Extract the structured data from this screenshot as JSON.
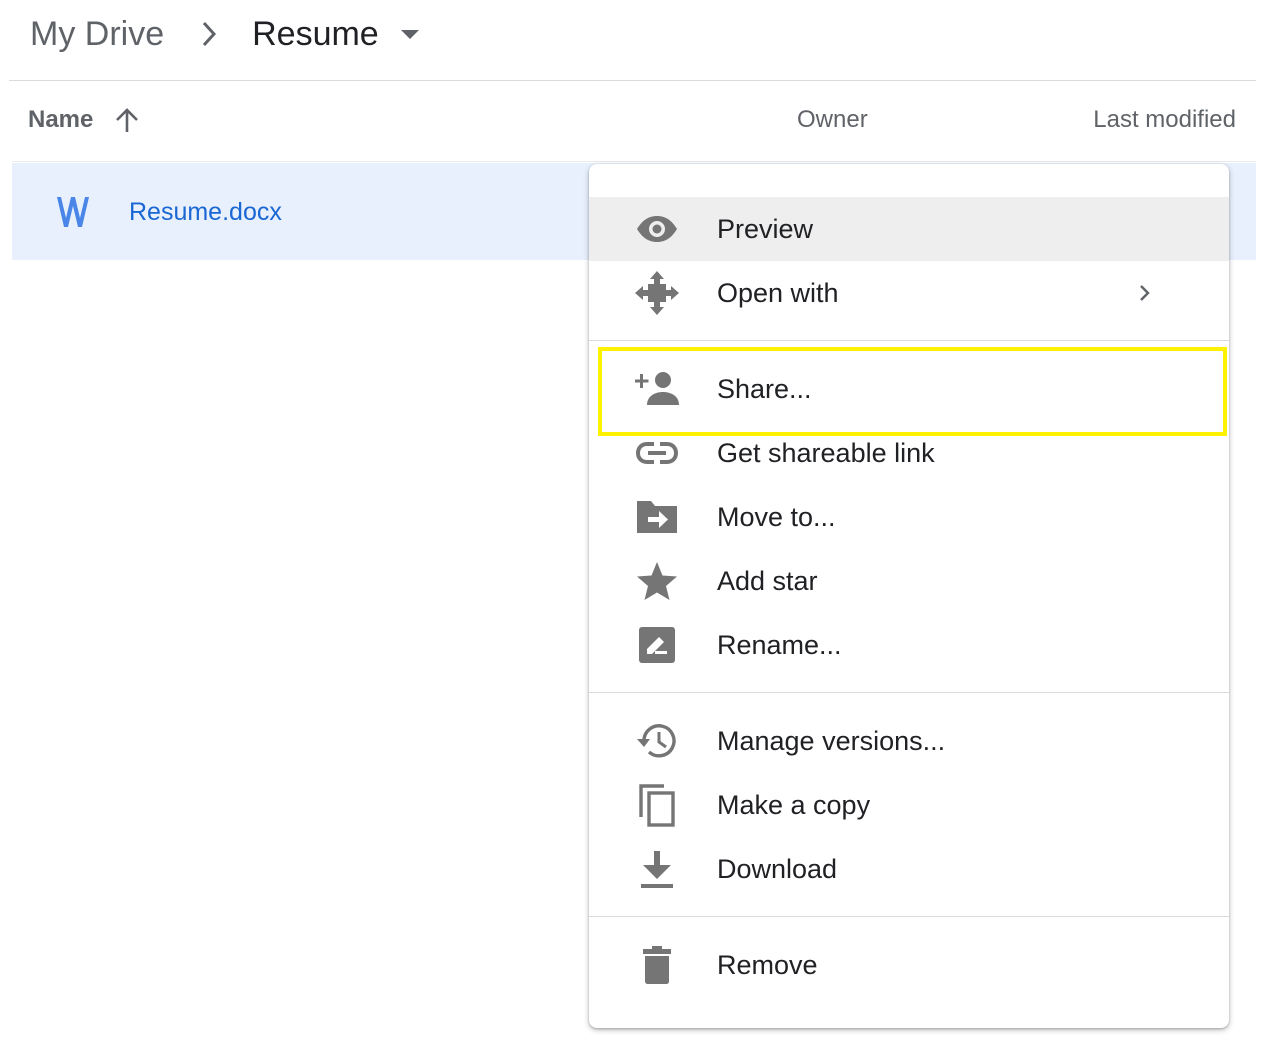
{
  "breadcrumb": {
    "root": "My Drive",
    "current": "Resume"
  },
  "columns": {
    "name": "Name",
    "owner": "Owner",
    "last_modified": "Last modified"
  },
  "file": {
    "name": "Resume.docx",
    "type_icon": "word-doc-icon",
    "icon_color": "#4a86e8"
  },
  "menu": {
    "items": [
      {
        "label": "Preview",
        "icon": "eye-icon"
      },
      {
        "label": "Open with",
        "icon": "open-with-icon"
      },
      {
        "label": "Share...",
        "icon": "add-person-icon"
      },
      {
        "label": "Get shareable link",
        "icon": "link-icon"
      },
      {
        "label": "Move to...",
        "icon": "move-folder-icon"
      },
      {
        "label": "Add star",
        "icon": "star-icon"
      },
      {
        "label": "Rename...",
        "icon": "rename-icon"
      },
      {
        "label": "Manage versions...",
        "icon": "history-icon"
      },
      {
        "label": "Make a copy",
        "icon": "copy-icon"
      },
      {
        "label": "Download",
        "icon": "download-icon"
      },
      {
        "label": "Remove",
        "icon": "trash-icon"
      }
    ]
  },
  "colors": {
    "selected_row": "#e8f0fe",
    "link_text": "#1967d2",
    "icon_gray": "#757575",
    "highlight": "#fff200"
  }
}
